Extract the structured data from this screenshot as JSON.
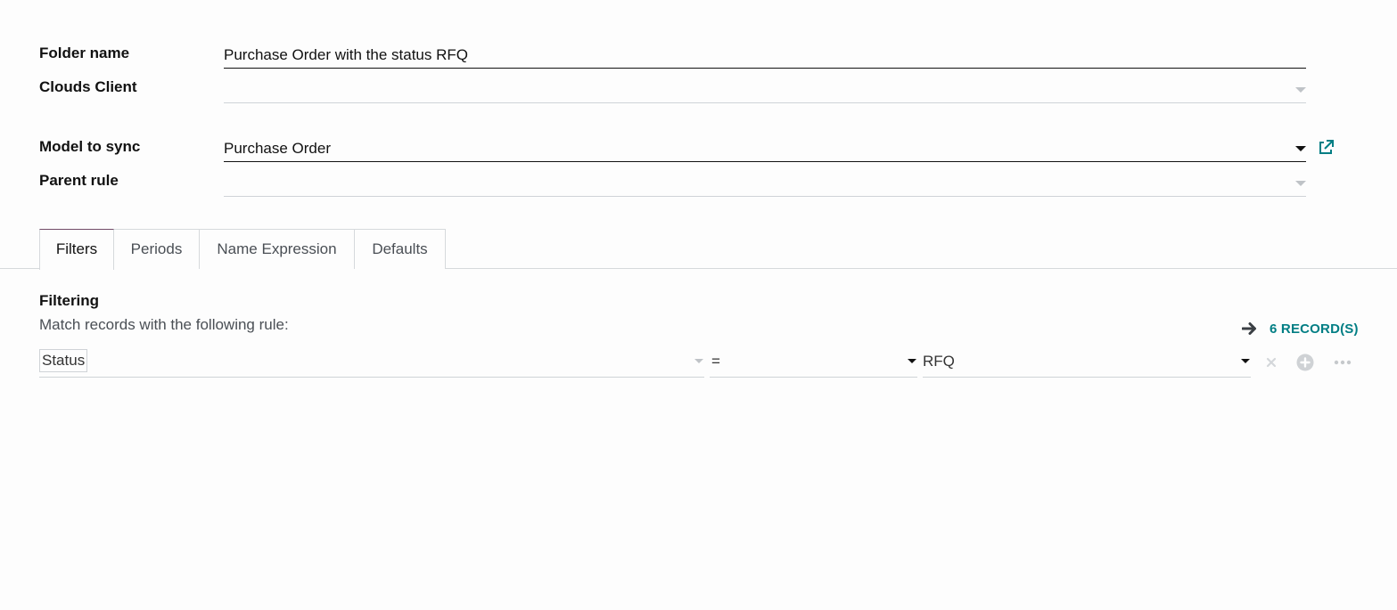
{
  "form": {
    "folder_name": {
      "label": "Folder name",
      "value": "Purchase Order with the status RFQ"
    },
    "clouds_client": {
      "label": "Clouds Client",
      "value": ""
    },
    "model_to_sync": {
      "label": "Model to sync",
      "value": "Purchase Order"
    },
    "parent_rule": {
      "label": "Parent rule",
      "value": ""
    }
  },
  "tabs": [
    {
      "label": "Filters",
      "active": true
    },
    {
      "label": "Periods",
      "active": false
    },
    {
      "label": "Name Expression",
      "active": false
    },
    {
      "label": "Defaults",
      "active": false
    }
  ],
  "filtering": {
    "title": "Filtering",
    "subtitle": "Match records with the following rule:",
    "records_label": "6 RECORD(S)",
    "rule": {
      "field": "Status",
      "operator": "=",
      "value": "RFQ"
    }
  },
  "colors": {
    "accent_teal": "#017e84",
    "active_tab_border": "#714b67"
  },
  "icons": {
    "external_link": "external-link-icon",
    "arrow_right": "arrow-right-icon",
    "delete": "close-icon",
    "add": "plus-circle-icon",
    "more": "ellipsis-icon"
  }
}
